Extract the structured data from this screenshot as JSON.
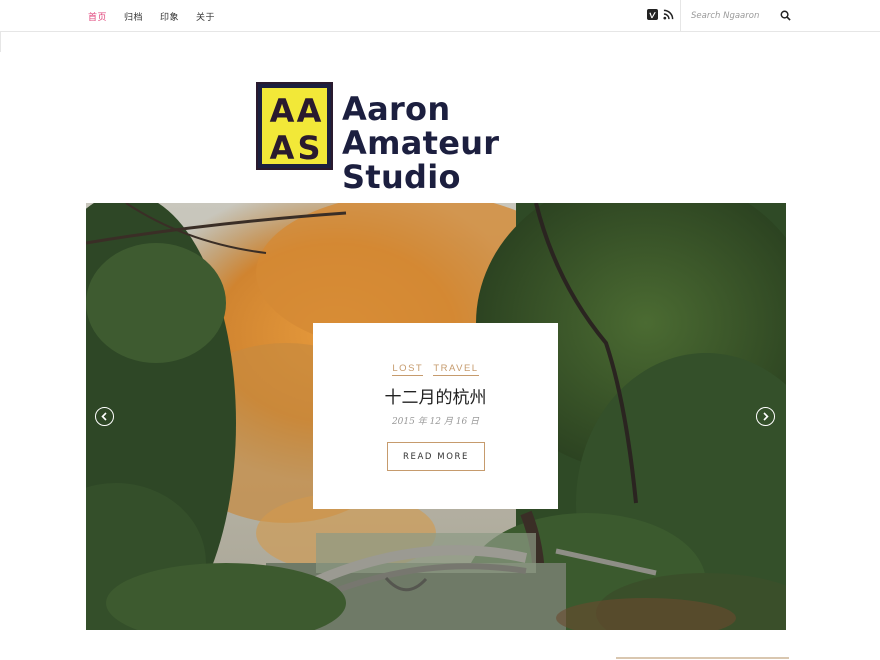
{
  "nav": {
    "items": [
      {
        "label": "首页",
        "active": true
      },
      {
        "label": "归档",
        "active": false
      },
      {
        "label": "印象",
        "active": false
      },
      {
        "label": "关于",
        "active": false
      }
    ]
  },
  "social": {
    "icons": [
      "vimeo-icon",
      "rss-icon"
    ]
  },
  "search": {
    "placeholder": "Search Ngaaron"
  },
  "logo": {
    "mark_text": "AAS",
    "line1": "Aaron",
    "line2": "Amateur Studio"
  },
  "slide": {
    "categories": [
      "LOST",
      "TRAVEL"
    ],
    "title": "十二月的杭州",
    "date": "2015 年 12 月 16 日",
    "button_label": "READ MORE"
  },
  "colors": {
    "accent_pink": "#e0457b",
    "accent_tan": "#c69b6d",
    "logo_navy": "#1c1f3f",
    "logo_yellow": "#f2e838"
  }
}
